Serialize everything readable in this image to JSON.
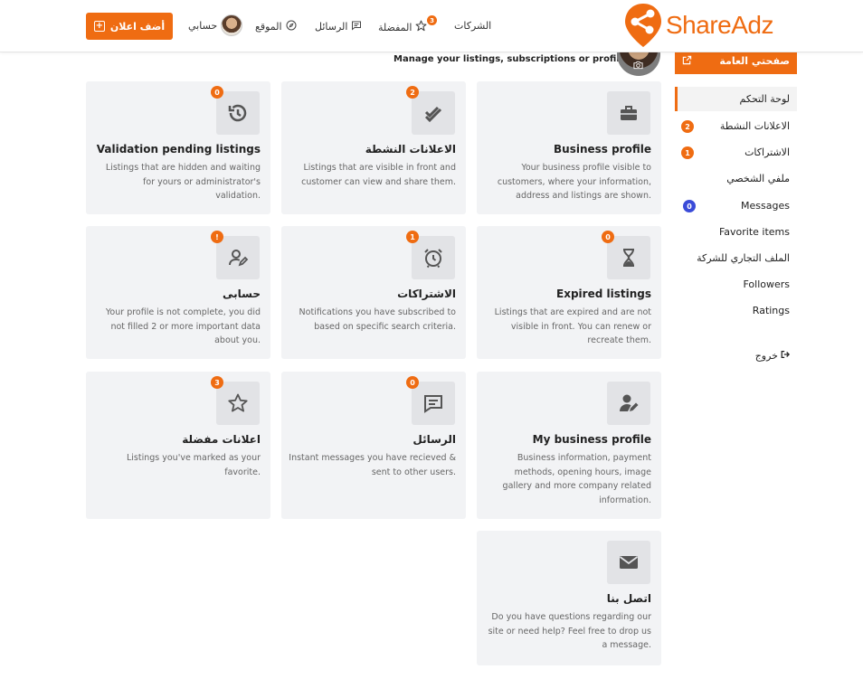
{
  "header": {
    "add_listing": "أضف اعلان",
    "account": "حسابي",
    "site": "الموقع",
    "messages": "الرسائل",
    "favorites": "المفضلة",
    "favorites_count": "3",
    "companies": "الشركات",
    "logo": "ShareAdz"
  },
  "profile": {
    "subtitle": "Manage your listings, subscriptions or profile"
  },
  "sidebar": {
    "public_page": "صفحتي العامة",
    "items": [
      {
        "label": "لوحة التحكم"
      },
      {
        "label": "الاعلانات النشطة",
        "badge": "2"
      },
      {
        "label": "الاشتراكات",
        "badge": "1"
      },
      {
        "label": "ملفي الشخصي"
      },
      {
        "label": "Messages",
        "badge": "0"
      },
      {
        "label": "Favorite items"
      },
      {
        "label": "الملف التجاري للشركة"
      },
      {
        "label": "Followers"
      },
      {
        "label": "Ratings"
      }
    ],
    "logout": "خروج"
  },
  "colors": {
    "accent": "#ef6c12",
    "messages_badge": "#3a4bd8"
  },
  "cards": [
    {
      "icon": "briefcase-icon",
      "title": "Business profile",
      "lines": [
        "Your business profile visible to",
        "customers, where your information,",
        "address and listings are shown."
      ]
    },
    {
      "icon": "double-check-icon",
      "badge": "2",
      "title": "الاعلانات النشطة",
      "lines": [
        "Listings that are visible in front and",
        "customer can view and share them."
      ]
    },
    {
      "icon": "history-icon",
      "badge": "0",
      "title": "Validation pending listings",
      "lines": [
        "Listings that are hidden and waiting",
        "for yours or administrator's",
        "validation."
      ]
    },
    {
      "icon": "hourglass-icon",
      "badge": "0",
      "title": "Expired listings",
      "lines": [
        "Listings that are expired and are not",
        "visible in front. You can renew or",
        "recreate them."
      ]
    },
    {
      "icon": "alarm-clock-icon",
      "badge": "1",
      "title": "الاشتراكات",
      "lines": [
        "Notifications you have subscribed to",
        "based on specific search criteria."
      ]
    },
    {
      "icon": "user-edit-icon",
      "badge": "!",
      "title": "حسابى",
      "lines": [
        "Your profile is not complete, you did",
        "not filled 2 or more important data",
        "about you."
      ]
    },
    {
      "icon": "business-user-edit-icon",
      "title": "My business profile",
      "lines": [
        "Business information, payment",
        "methods, opening hours, image",
        "gallery and more company related",
        "information."
      ]
    },
    {
      "icon": "chat-icon",
      "badge": "0",
      "title": "الرسائل",
      "lines": [
        "Instant messages you have recieved &",
        "sent to other users."
      ]
    },
    {
      "icon": "star-icon",
      "badge": "3",
      "title": "اعلانات مفضلة",
      "lines": [
        "Listings you've marked as your",
        "favorite."
      ]
    },
    {
      "icon": "envelope-icon",
      "title": "اتصل بنا",
      "lines": [
        "Do you have questions regarding our",
        "site or need help? Feel free to drop us",
        "a message."
      ]
    }
  ]
}
